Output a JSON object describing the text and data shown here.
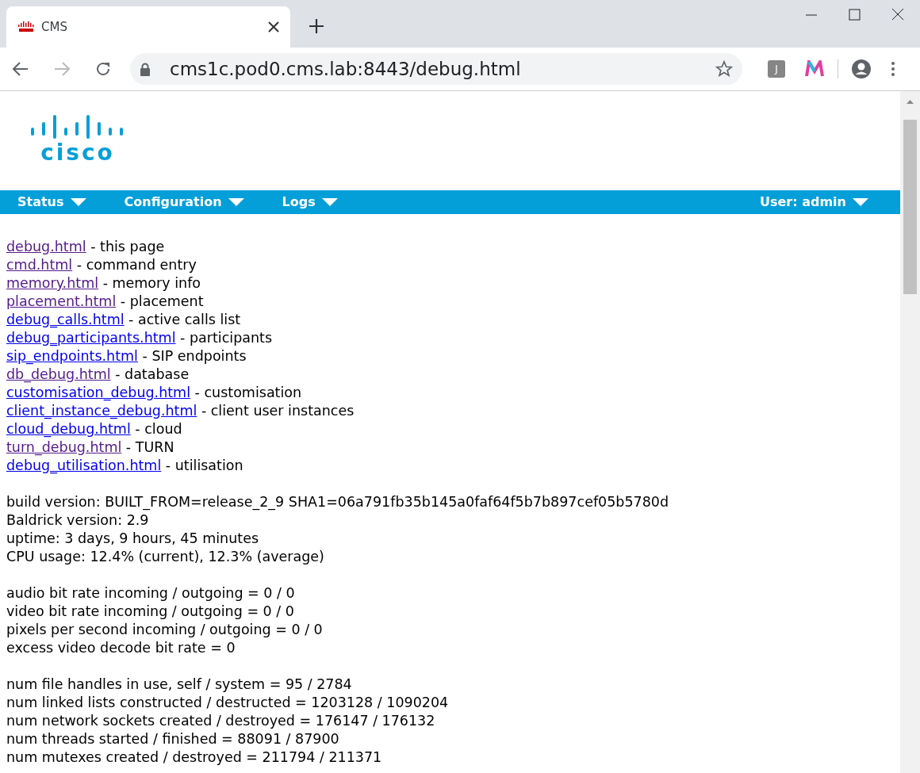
{
  "browser": {
    "tab_title": "CMS",
    "url": "cms1c.pod0.cms.lab:8443/debug.html",
    "extension_label": "J"
  },
  "logo_text": "cisco",
  "nav": {
    "menus": [
      {
        "label": "Status"
      },
      {
        "label": "Configuration"
      },
      {
        "label": "Logs"
      }
    ],
    "user_menu": "User: admin"
  },
  "links": [
    {
      "link": "debug.html",
      "description": " - this page",
      "visited": true
    },
    {
      "link": "cmd.html",
      "description": " - command entry",
      "visited": true
    },
    {
      "link": "memory.html",
      "description": " - memory info",
      "visited": true
    },
    {
      "link": "placement.html",
      "description": " - placement",
      "visited": true
    },
    {
      "link": "debug_calls.html",
      "description": " - active calls list",
      "visited": false
    },
    {
      "link": "debug_participants.html",
      "description": " - participants",
      "visited": false
    },
    {
      "link": "sip_endpoints.html",
      "description": " - SIP endpoints",
      "visited": false
    },
    {
      "link": "db_debug.html",
      "description": " - database",
      "visited": true
    },
    {
      "link": "customisation_debug.html",
      "description": " - customisation",
      "visited": false
    },
    {
      "link": "client_instance_debug.html",
      "description": " - client user instances",
      "visited": false
    },
    {
      "link": "cloud_debug.html",
      "description": " - cloud",
      "visited": false
    },
    {
      "link": "turn_debug.html",
      "description": " - TURN",
      "visited": true
    },
    {
      "link": "debug_utilisation.html",
      "description": " - utilisation",
      "visited": false
    }
  ],
  "stat_groups": [
    [
      "build version: BUILT_FROM=release_2_9 SHA1=06a791fb35b145a0faf64f5b7b897cef05b5780d",
      "Baldrick version: 2.9",
      "uptime: 3 days, 9 hours, 45 minutes",
      "CPU usage: 12.4% (current), 12.3% (average)"
    ],
    [
      "audio bit rate incoming / outgoing = 0 / 0",
      "video bit rate incoming / outgoing = 0 / 0",
      "pixels per second incoming / outgoing = 0 / 0",
      "excess video decode bit rate = 0"
    ],
    [
      "num file handles in use, self / system = 95 / 2784",
      "num linked lists constructed / destructed = 1203128 / 1090204",
      "num network sockets created / destroyed = 176147 / 176132",
      "num threads started / finished = 88091 / 87900",
      "num mutexes created / destroyed = 211794 / 211371"
    ]
  ]
}
